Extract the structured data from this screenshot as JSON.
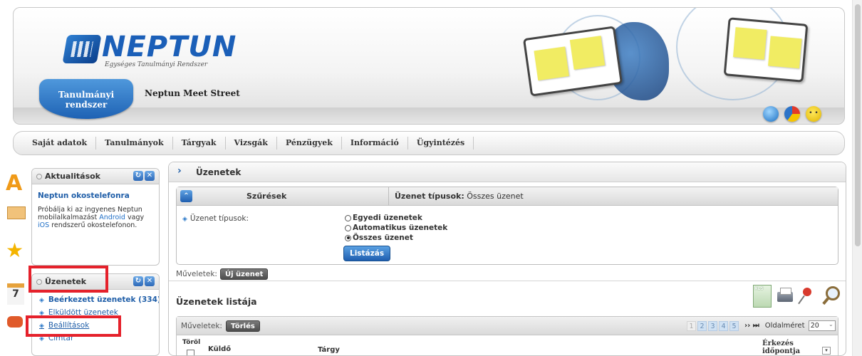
{
  "header": {
    "logo_word": "NEPTUN",
    "logo_subtitle": "Egységes Tanulmányi Rendszer",
    "system_tab": "Tanulmányi rendszer",
    "meet_street": "Neptun Meet Street",
    "icons": [
      "globe-icon",
      "pie-chart-icon",
      "smiley-icon"
    ]
  },
  "menu": {
    "items": [
      "Saját adatok",
      "Tanulmányok",
      "Tárgyak",
      "Vizsgák",
      "Pénzügyek",
      "Információ",
      "Ügyintézés"
    ]
  },
  "widget_news": {
    "title": "Aktualitások",
    "headline": "Neptun okostelefonra",
    "text_before": "Próbálja ki az ingyenes Neptun mobilalkalmazást",
    "link_android": "Android",
    "text_mid": "vagy",
    "link_ios": "iOS",
    "text_after": "rendszerű okostelefonon."
  },
  "widget_messages": {
    "title": "Üzenetek",
    "items": [
      {
        "label": "Beérkezett üzenetek (334)"
      },
      {
        "label": "Elküldött üzenetek"
      },
      {
        "label": "Beállítások"
      },
      {
        "label": "Címtár"
      }
    ]
  },
  "main": {
    "title": "Üzenetek",
    "filter": {
      "header_label": "Szűrések",
      "type_label": "Üzenet típusok:",
      "type_value": "Összes üzenet",
      "field_label": "Üzenet típusok:",
      "options": [
        "Egyedi üzenetek",
        "Automatikus üzenetek",
        "Összes üzenet"
      ],
      "selected_index": 2,
      "list_button": "Listázás"
    },
    "operations_label": "Műveletek:",
    "new_message_button": "Új üzenet",
    "list_title": "Üzenetek listája",
    "grid": {
      "operations_label": "Műveletek:",
      "delete_button": "Törlés",
      "pages": [
        "1",
        "2",
        "3",
        "4",
        "5"
      ],
      "nav": "›› ⏭",
      "page_size_label": "Oldalméret",
      "page_size_value": "20",
      "columns": {
        "delete": "Töröl",
        "sender": "Küldő",
        "subject": "Tárgy",
        "arrival": "Érkezés időpontja"
      }
    }
  },
  "colors": {
    "accent_blue": "#1f5ea8",
    "highlight_red": "#e5212b"
  }
}
